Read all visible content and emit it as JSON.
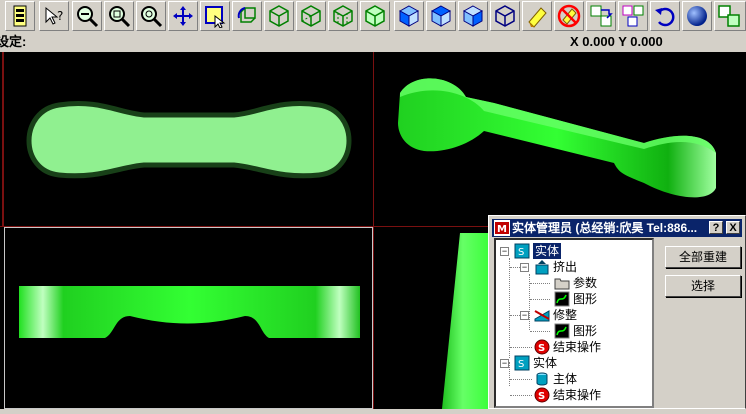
{
  "toolbar": {
    "buttons": [
      "layer-icon",
      "select-help-icon",
      "zoom-out-icon",
      "zoom-window-icon",
      "zoom-fit-icon",
      "pan-icon",
      "select-window-icon",
      "rotate-view-icon",
      "wireframe-cube-icon",
      "wireframe-cube-2-icon",
      "hidden-line-cube-icon",
      "shaded-wire-cube-icon",
      "front-view-cube-icon",
      "top-view-cube-icon",
      "side-view-cube-icon",
      "iso-view-cube-icon",
      "eraser-icon",
      "no-erase-icon",
      "move-icon",
      "copy-icon",
      "undo-icon",
      "sphere-icon",
      "window-layout-icon"
    ]
  },
  "status": {
    "label": "设定:",
    "coords": "X 0.000  Y 0.000"
  },
  "colors": {
    "viewport_bg": "#000000",
    "part_green": "#33ff33",
    "top_view_fill": "#90f090",
    "title_bar": "#0a246a"
  },
  "manager": {
    "title": "实体管理员 (总经销:欣昊 Tel:886...",
    "help_label": "?",
    "close_label": "X",
    "rebuild_all_label": "全部重建",
    "select_label": "选择",
    "tree": {
      "solid1": "实体",
      "extrude": "挤出",
      "params": "参数",
      "graphic1": "图形",
      "trim": "修整",
      "graphic2": "图形",
      "end_op1": "结束操作",
      "solid2": "实体",
      "body": "主体",
      "end_op2": "结束操作"
    }
  }
}
